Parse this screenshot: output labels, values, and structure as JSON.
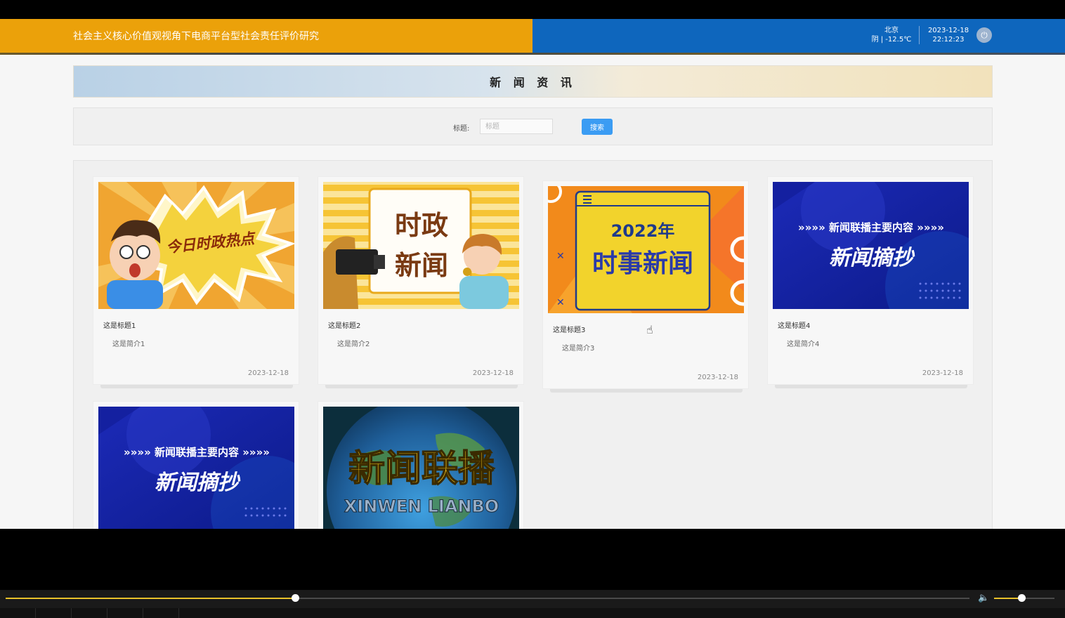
{
  "header": {
    "site_title": "社会主义核心价值观视角下电商平台型社会责任评价研究",
    "weather_city": "北京",
    "weather_desc": "阴 | -12.5℃",
    "date": "2023-12-18",
    "time": "22:12:23",
    "power_icon": "power-icon"
  },
  "page": {
    "title": "新 闻 资 讯"
  },
  "search": {
    "label": "标题:",
    "placeholder": "标题",
    "button_label": "搜索"
  },
  "news": [
    {
      "title": "这是标题1",
      "summary": "这是简介1",
      "date": "2023-12-18",
      "image_text": "今日时政热点"
    },
    {
      "title": "这是标题2",
      "summary": "这是简介2",
      "date": "2023-12-18",
      "image_text_1": "时政",
      "image_text_2": "新闻"
    },
    {
      "title": "这是标题3",
      "summary": "这是简介3",
      "date": "2023-12-18",
      "image_text_1": "2022年",
      "image_text_2": "时事新闻"
    },
    {
      "title": "这是标题4",
      "summary": "这是简介4",
      "date": "2023-12-18",
      "image_text_1": "»»»» 新闻联播主要内容 »»»»",
      "image_text_2": "新闻摘抄"
    },
    {
      "image_text_1": "»»»» 新闻联播主要内容 »»»»",
      "image_text_2": "新闻摘抄"
    },
    {
      "image_text_1": "新闻联播",
      "image_text_2": "XINWEN LIANBO"
    }
  ],
  "player": {
    "progress_fraction": 0.3,
    "volume_fraction": 0.45
  },
  "colors": {
    "header_orange": "#eba10a",
    "header_blue": "#0e66bd",
    "search_button": "#3b9cf3",
    "progress": "#e9c22a"
  }
}
